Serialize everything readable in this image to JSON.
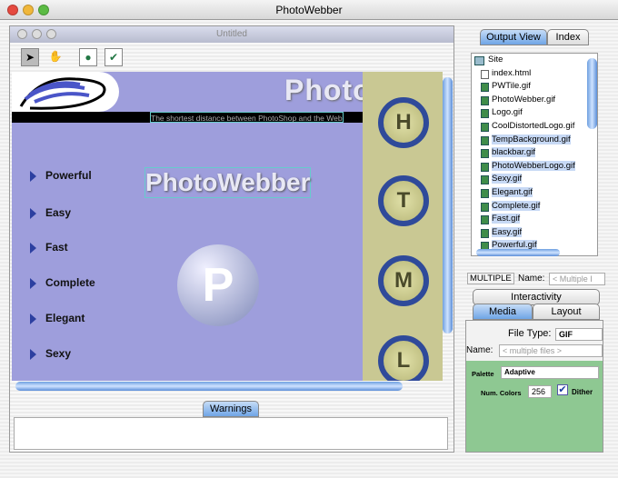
{
  "app_title": "PhotoWebber",
  "document": {
    "title": "Untitled",
    "tools": [
      "arrow-tool",
      "hand-tool",
      "preview-tool",
      "check-tool"
    ]
  },
  "canvas": {
    "banner_title": "PhotoWebber",
    "tagline": "The shortest distance between PhotoShop and the Web",
    "logo_text": "PhotoWebber",
    "logo_letter": "P",
    "nav_items": [
      "Powerful",
      "Easy",
      "Fast",
      "Complete",
      "Elegant",
      "Sexy"
    ],
    "circle_buttons": [
      "H",
      "T",
      "M",
      "L"
    ]
  },
  "warnings": {
    "tab_label": "Warnings",
    "text": ""
  },
  "panel": {
    "tabs": [
      "Output View",
      "Index"
    ],
    "tree_root": "Site",
    "files": [
      {
        "name": "index.html",
        "type": "html",
        "selected": false
      },
      {
        "name": "PWTile.gif",
        "type": "gif",
        "selected": false
      },
      {
        "name": "PhotoWebber.gif",
        "type": "gif",
        "selected": false
      },
      {
        "name": "Logo.gif",
        "type": "gif",
        "selected": false
      },
      {
        "name": "CoolDistortedLogo.gif",
        "type": "gif",
        "selected": false
      },
      {
        "name": "TempBackground.gif",
        "type": "gif",
        "selected": true
      },
      {
        "name": "blackbar.gif",
        "type": "gif",
        "selected": true
      },
      {
        "name": "PhotoWebberLogo.gif",
        "type": "gif",
        "selected": true
      },
      {
        "name": "Sexy.gif",
        "type": "gif",
        "selected": true
      },
      {
        "name": "Elegant.gif",
        "type": "gif",
        "selected": true
      },
      {
        "name": "Complete.gif",
        "type": "gif",
        "selected": true
      },
      {
        "name": "Fast.gif",
        "type": "gif",
        "selected": true
      },
      {
        "name": "Easy.gif",
        "type": "gif",
        "selected": true
      },
      {
        "name": "Powerful.gif",
        "type": "gif",
        "selected": true
      }
    ],
    "kind_label": "MULTIPLE",
    "name_label": "Name:",
    "name_placeholder": "< Multiple I",
    "prop_tabs": {
      "interactivity": "Interactivity",
      "media": "Media",
      "layout": "Layout"
    },
    "file_type_label": "File Type:",
    "file_type_value": "GIF",
    "file_name_label": "Name:",
    "file_name_placeholder": "< multiple files >",
    "palette_label": "Palette",
    "palette_value": "Adaptive",
    "num_colors_label": "Num. Colors",
    "num_colors_value": "256",
    "dither_label": "Dither",
    "dither_checked": true
  }
}
